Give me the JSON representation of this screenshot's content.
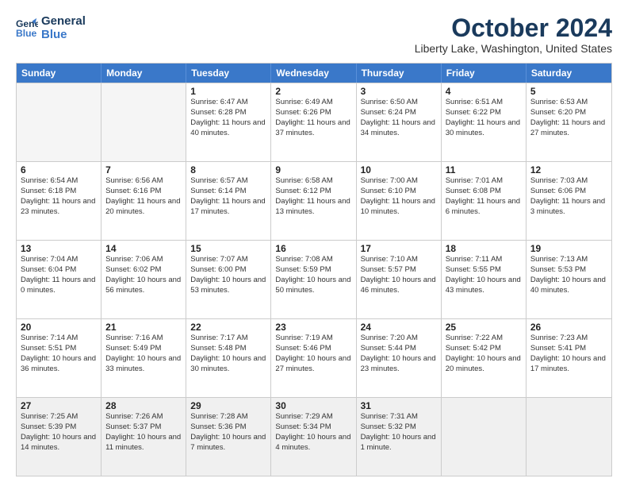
{
  "header": {
    "logo_line1": "General",
    "logo_line2": "Blue",
    "month": "October 2024",
    "location": "Liberty Lake, Washington, United States"
  },
  "days_of_week": [
    "Sunday",
    "Monday",
    "Tuesday",
    "Wednesday",
    "Thursday",
    "Friday",
    "Saturday"
  ],
  "rows": [
    [
      {
        "day": "",
        "empty": true
      },
      {
        "day": "",
        "empty": true
      },
      {
        "day": "1",
        "sunrise": "Sunrise: 6:47 AM",
        "sunset": "Sunset: 6:28 PM",
        "daylight": "Daylight: 11 hours and 40 minutes."
      },
      {
        "day": "2",
        "sunrise": "Sunrise: 6:49 AM",
        "sunset": "Sunset: 6:26 PM",
        "daylight": "Daylight: 11 hours and 37 minutes."
      },
      {
        "day": "3",
        "sunrise": "Sunrise: 6:50 AM",
        "sunset": "Sunset: 6:24 PM",
        "daylight": "Daylight: 11 hours and 34 minutes."
      },
      {
        "day": "4",
        "sunrise": "Sunrise: 6:51 AM",
        "sunset": "Sunset: 6:22 PM",
        "daylight": "Daylight: 11 hours and 30 minutes."
      },
      {
        "day": "5",
        "sunrise": "Sunrise: 6:53 AM",
        "sunset": "Sunset: 6:20 PM",
        "daylight": "Daylight: 11 hours and 27 minutes."
      }
    ],
    [
      {
        "day": "6",
        "sunrise": "Sunrise: 6:54 AM",
        "sunset": "Sunset: 6:18 PM",
        "daylight": "Daylight: 11 hours and 23 minutes."
      },
      {
        "day": "7",
        "sunrise": "Sunrise: 6:56 AM",
        "sunset": "Sunset: 6:16 PM",
        "daylight": "Daylight: 11 hours and 20 minutes."
      },
      {
        "day": "8",
        "sunrise": "Sunrise: 6:57 AM",
        "sunset": "Sunset: 6:14 PM",
        "daylight": "Daylight: 11 hours and 17 minutes."
      },
      {
        "day": "9",
        "sunrise": "Sunrise: 6:58 AM",
        "sunset": "Sunset: 6:12 PM",
        "daylight": "Daylight: 11 hours and 13 minutes."
      },
      {
        "day": "10",
        "sunrise": "Sunrise: 7:00 AM",
        "sunset": "Sunset: 6:10 PM",
        "daylight": "Daylight: 11 hours and 10 minutes."
      },
      {
        "day": "11",
        "sunrise": "Sunrise: 7:01 AM",
        "sunset": "Sunset: 6:08 PM",
        "daylight": "Daylight: 11 hours and 6 minutes."
      },
      {
        "day": "12",
        "sunrise": "Sunrise: 7:03 AM",
        "sunset": "Sunset: 6:06 PM",
        "daylight": "Daylight: 11 hours and 3 minutes."
      }
    ],
    [
      {
        "day": "13",
        "sunrise": "Sunrise: 7:04 AM",
        "sunset": "Sunset: 6:04 PM",
        "daylight": "Daylight: 11 hours and 0 minutes."
      },
      {
        "day": "14",
        "sunrise": "Sunrise: 7:06 AM",
        "sunset": "Sunset: 6:02 PM",
        "daylight": "Daylight: 10 hours and 56 minutes."
      },
      {
        "day": "15",
        "sunrise": "Sunrise: 7:07 AM",
        "sunset": "Sunset: 6:00 PM",
        "daylight": "Daylight: 10 hours and 53 minutes."
      },
      {
        "day": "16",
        "sunrise": "Sunrise: 7:08 AM",
        "sunset": "Sunset: 5:59 PM",
        "daylight": "Daylight: 10 hours and 50 minutes."
      },
      {
        "day": "17",
        "sunrise": "Sunrise: 7:10 AM",
        "sunset": "Sunset: 5:57 PM",
        "daylight": "Daylight: 10 hours and 46 minutes."
      },
      {
        "day": "18",
        "sunrise": "Sunrise: 7:11 AM",
        "sunset": "Sunset: 5:55 PM",
        "daylight": "Daylight: 10 hours and 43 minutes."
      },
      {
        "day": "19",
        "sunrise": "Sunrise: 7:13 AM",
        "sunset": "Sunset: 5:53 PM",
        "daylight": "Daylight: 10 hours and 40 minutes."
      }
    ],
    [
      {
        "day": "20",
        "sunrise": "Sunrise: 7:14 AM",
        "sunset": "Sunset: 5:51 PM",
        "daylight": "Daylight: 10 hours and 36 minutes."
      },
      {
        "day": "21",
        "sunrise": "Sunrise: 7:16 AM",
        "sunset": "Sunset: 5:49 PM",
        "daylight": "Daylight: 10 hours and 33 minutes."
      },
      {
        "day": "22",
        "sunrise": "Sunrise: 7:17 AM",
        "sunset": "Sunset: 5:48 PM",
        "daylight": "Daylight: 10 hours and 30 minutes."
      },
      {
        "day": "23",
        "sunrise": "Sunrise: 7:19 AM",
        "sunset": "Sunset: 5:46 PM",
        "daylight": "Daylight: 10 hours and 27 minutes."
      },
      {
        "day": "24",
        "sunrise": "Sunrise: 7:20 AM",
        "sunset": "Sunset: 5:44 PM",
        "daylight": "Daylight: 10 hours and 23 minutes."
      },
      {
        "day": "25",
        "sunrise": "Sunrise: 7:22 AM",
        "sunset": "Sunset: 5:42 PM",
        "daylight": "Daylight: 10 hours and 20 minutes."
      },
      {
        "day": "26",
        "sunrise": "Sunrise: 7:23 AM",
        "sunset": "Sunset: 5:41 PM",
        "daylight": "Daylight: 10 hours and 17 minutes."
      }
    ],
    [
      {
        "day": "27",
        "sunrise": "Sunrise: 7:25 AM",
        "sunset": "Sunset: 5:39 PM",
        "daylight": "Daylight: 10 hours and 14 minutes."
      },
      {
        "day": "28",
        "sunrise": "Sunrise: 7:26 AM",
        "sunset": "Sunset: 5:37 PM",
        "daylight": "Daylight: 10 hours and 11 minutes."
      },
      {
        "day": "29",
        "sunrise": "Sunrise: 7:28 AM",
        "sunset": "Sunset: 5:36 PM",
        "daylight": "Daylight: 10 hours and 7 minutes."
      },
      {
        "day": "30",
        "sunrise": "Sunrise: 7:29 AM",
        "sunset": "Sunset: 5:34 PM",
        "daylight": "Daylight: 10 hours and 4 minutes."
      },
      {
        "day": "31",
        "sunrise": "Sunrise: 7:31 AM",
        "sunset": "Sunset: 5:32 PM",
        "daylight": "Daylight: 10 hours and 1 minute."
      },
      {
        "day": "",
        "empty": true
      },
      {
        "day": "",
        "empty": true
      }
    ]
  ]
}
